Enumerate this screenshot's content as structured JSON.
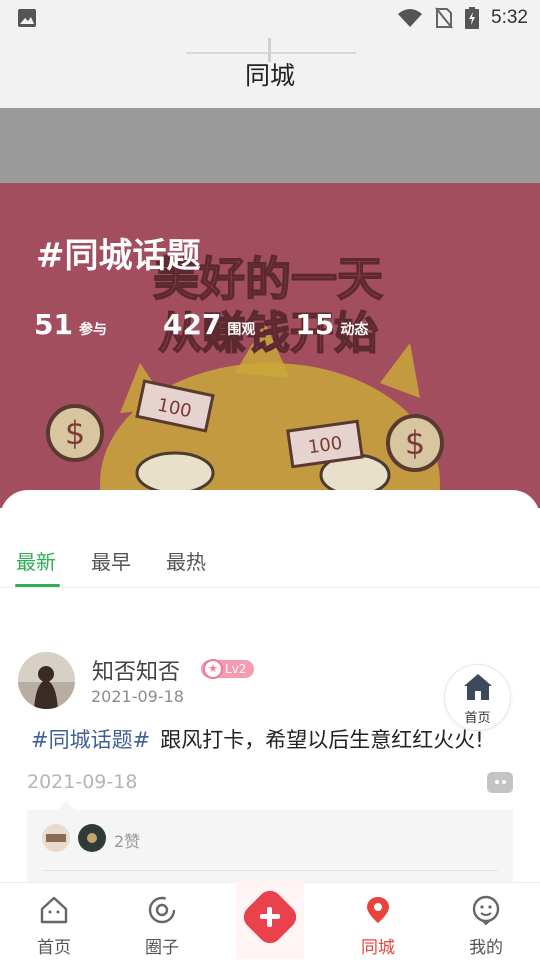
{
  "status_bar": {
    "time": "5:32"
  },
  "header": {
    "title": "同城"
  },
  "banner": {
    "topic": "#同城话题",
    "stats": [
      {
        "value": "51",
        "label": "参与"
      },
      {
        "value": "427",
        "label": "围观"
      },
      {
        "value": "15",
        "label": "动态"
      }
    ],
    "image_text_line1": "美好的一天",
    "image_text_line2": "从赚钱开始",
    "image_note": "100"
  },
  "tabs": [
    {
      "label": "最新",
      "active": true
    },
    {
      "label": "最早",
      "active": false
    },
    {
      "label": "最热",
      "active": false
    }
  ],
  "post": {
    "author": "知否知否",
    "level": "Lv2",
    "date": "2021-09-18",
    "tag": "#同城话题#",
    "text": "跟风打卡，希望以后生意红红火火!",
    "footer_date": "2021-09-18",
    "likes": "2赞"
  },
  "float_button": {
    "label": "首页"
  },
  "bottom_nav": [
    {
      "label": "首页",
      "icon": "home-icon"
    },
    {
      "label": "圈子",
      "icon": "circle-icon"
    },
    {
      "label": "",
      "icon": "plus-icon"
    },
    {
      "label": "同城",
      "icon": "location-pin-icon",
      "active": true
    },
    {
      "label": "我的",
      "icon": "profile-face-icon"
    }
  ],
  "colors": {
    "accent_green": "#2fae55",
    "accent_red": "#e8443c",
    "banner": "#a34e5f",
    "tag_blue": "#3f5f96"
  }
}
